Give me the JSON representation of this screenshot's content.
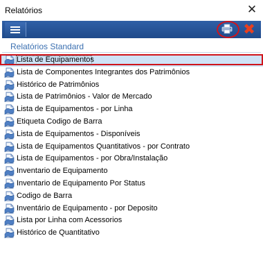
{
  "window": {
    "title": "Relatórios",
    "close_glyph": "✕"
  },
  "toolbar": {
    "menu_icon": "hamburger-icon",
    "print_icon": "printer-icon",
    "cancel_icon": "red-x-icon",
    "cancel_glyph": "✖"
  },
  "section": {
    "title": "Relatórios Standard"
  },
  "reports": {
    "selected_index": 0,
    "items": [
      {
        "label": "Lista de Equipamentos"
      },
      {
        "label": "Lista de Componentes Integrantes dos Patrimônios"
      },
      {
        "label": "Histórico de Patrimônios"
      },
      {
        "label": "Lista de Patrimônios - Valor de Mercado"
      },
      {
        "label": "Lista de Equipamentos - por Linha"
      },
      {
        "label": "Etiqueta Codigo de Barra"
      },
      {
        "label": "Lista de Equipamentos - Disponíveis"
      },
      {
        "label": "Lista de Equipamentos Quantitativos - por Contrato"
      },
      {
        "label": "Lista de Equipamentos - por Obra/Instalação"
      },
      {
        "label": "Inventario de Equipamento"
      },
      {
        "label": "Inventario de Equipamento Por Status"
      },
      {
        "label": "Codigo de Barra"
      },
      {
        "label": "Inventário de Equipamento - por Deposito"
      },
      {
        "label": "Lista por Linha com Acessorios"
      },
      {
        "label": "Histórico de Quantitativo"
      }
    ]
  },
  "colors": {
    "toolbar_blue": "#1f4a8a",
    "section_text": "#3a6fb0",
    "highlight_red": "#d0141b",
    "selection_bg": "#cfe3f7"
  }
}
